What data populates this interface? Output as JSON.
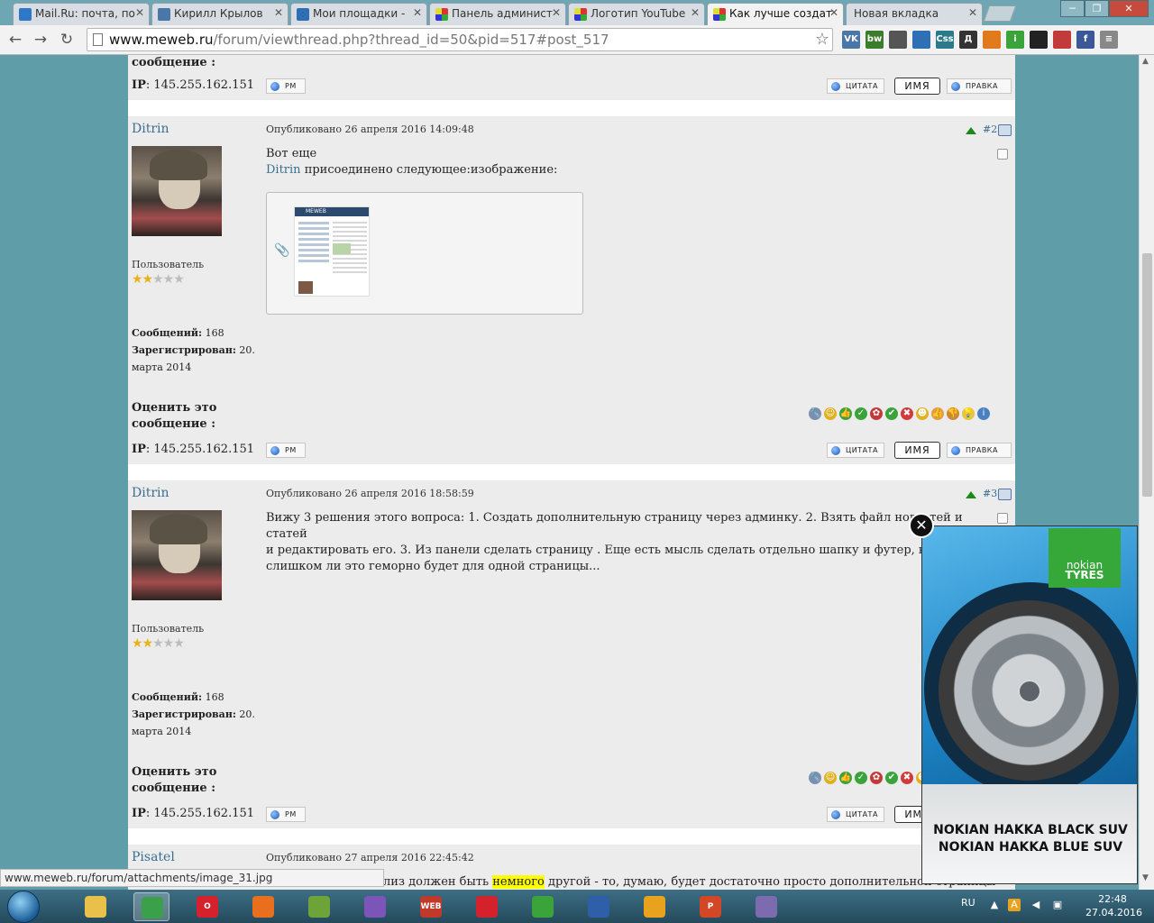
{
  "browser": {
    "tabs": [
      {
        "title": "Mail.Ru: почта, по",
        "color": "#2d79c7"
      },
      {
        "title": "Кирилл Крылов",
        "color": "#4a76a8"
      },
      {
        "title": "Мои площадки -",
        "color": "#2e6fb5"
      },
      {
        "title": "Панель админист",
        "color": "#c23b3b"
      },
      {
        "title": "Логотип YouTube",
        "color": "#c23b3b"
      },
      {
        "title": "Как лучше создат",
        "color": "#c23b3b"
      },
      {
        "title": "Новая вкладка",
        "color": ""
      }
    ],
    "url_host": "www.meweb.ru",
    "url_path": "/forum/viewthread.php?thread_id=50&pid=517#post_517",
    "extensions": [
      {
        "name": "vk-icon",
        "label": "VK",
        "color": "#4a76a8"
      },
      {
        "name": "bw-icon",
        "label": "bw",
        "color": "#3b7d2b"
      },
      {
        "name": "ruler-icon",
        "label": "",
        "color": "#555555"
      },
      {
        "name": "screen-icon",
        "label": "",
        "color": "#2f6fb3"
      },
      {
        "name": "css-icon",
        "label": "Css",
        "color": "#2b7a8c"
      },
      {
        "name": "dict-icon",
        "label": "Д",
        "color": "#333333"
      },
      {
        "name": "clock-icon",
        "label": "",
        "color": "#e07a1d"
      },
      {
        "name": "info-icon",
        "label": "i",
        "color": "#3aa33a"
      },
      {
        "name": "check-icon",
        "label": "",
        "color": "#222222"
      },
      {
        "name": "flag-icon",
        "label": "",
        "color": "#c23b3b"
      },
      {
        "name": "facebook-icon",
        "label": "f",
        "color": "#3b5998"
      },
      {
        "name": "menu-icon",
        "label": "≡",
        "color": "#888888"
      }
    ]
  },
  "forum": {
    "top_rate_tail": "сообщение :",
    "ip_label": "IP",
    "ip_value": ": 145.255.162.151",
    "btn_pm": "PM",
    "btn_quote": "ЦИТАТА",
    "btn_name": "ИМЯ",
    "btn_edit": "ПРАВКА",
    "rate_label_1": "Оценить это",
    "rate_label_2": "сообщение :",
    "posts": [
      {
        "author": "Ditrin",
        "posted": "Опубликовано 26 апреля 2016 14:09:48",
        "num": "#2",
        "body_line1": "Вот еще",
        "attach_user": "Ditrin",
        "attach_text": " присоединено следующее:изображение:",
        "role": "Пользователь",
        "stars_on": "★★",
        "stars_off": "★★★",
        "msgs_label": "Сообщений:",
        "msgs_value": " 168",
        "reg_label": "Зарегистрирован:",
        "reg_value": " 20.",
        "reg_value2": "марта 2014",
        "thumb_brand": "MEWEB"
      },
      {
        "author": "Ditrin",
        "posted": "Опубликовано 26 апреля 2016 18:58:59",
        "num": "#3",
        "body_l1": "Вижу 3 решения этого вопроса: 1. Создать дополнительную страницу через админку. 2. Взять файл новостей и статей",
        "body_l2": "и редактировать его. 3. Из панели сделать страницу . Еще есть мысль сделать отдельно шапку и футер, но вот",
        "body_l3": "слишком ли это геморно будет для одной страницы...",
        "role": "Пользователь",
        "stars_on": "★★",
        "stars_off": "★★★",
        "msgs_label": "Сообщений:",
        "msgs_value": " 168",
        "reg_label": "Зарегистрирован:",
        "reg_value": " 20.",
        "reg_value2": "марта 2014"
      },
      {
        "author": "Pisatel",
        "posted": "Опубликовано 27 апреля 2016 22:45:42",
        "body_pre": "лиз должен быть ",
        "body_hl": "немного",
        "body_post": " другой - то, думаю, будет достаточно просто дополнительной страницы"
      }
    ],
    "emoticons": [
      {
        "name": "wrench-icon",
        "glyph": "🔧",
        "color": "#7b8fb0"
      },
      {
        "name": "smile-icon",
        "glyph": "☺",
        "color": "#e0b020"
      },
      {
        "name": "thumbs-up-box-icon",
        "glyph": "👍",
        "color": "#3aa33a"
      },
      {
        "name": "ok-circle-icon",
        "glyph": "✓",
        "color": "#3aa33a"
      },
      {
        "name": "ribbon-icon",
        "glyph": "✿",
        "color": "#c23b3b"
      },
      {
        "name": "checkmark-icon",
        "glyph": "✔",
        "color": "#3aa33a"
      },
      {
        "name": "cross-icon",
        "glyph": "✖",
        "color": "#d13b3b"
      },
      {
        "name": "wink-icon",
        "glyph": "☻",
        "color": "#e0b020"
      },
      {
        "name": "thumbs-up-icon",
        "glyph": "👍",
        "color": "#e0a040"
      },
      {
        "name": "thumbs-down-icon",
        "glyph": "👎",
        "color": "#c98a3a"
      },
      {
        "name": "bulb-icon",
        "glyph": "💡",
        "color": "#e8c43a"
      },
      {
        "name": "info-circle-icon",
        "glyph": "i",
        "color": "#4a7fc0"
      }
    ]
  },
  "status_url": "www.meweb.ru/forum/attachments/image_31.jpg",
  "ad": {
    "brand_line1": "nokian",
    "brand_line2": "TYRES",
    "line1": "NOKIAN HAKKA BLACK SUV",
    "line2": "NOKIAN HAKKA BLUE SUV"
  },
  "taskbar": {
    "apps": [
      {
        "name": "explorer-icon",
        "label": "",
        "color": "#e8c04a"
      },
      {
        "name": "chrome-icon",
        "label": "",
        "color": "#3aa14a"
      },
      {
        "name": "opera-icon",
        "label": "O",
        "color": "#d4212b"
      },
      {
        "name": "firefox-icon",
        "label": "",
        "color": "#e76f1e"
      },
      {
        "name": "notepad-icon",
        "label": "",
        "color": "#6ea339"
      },
      {
        "name": "viber-icon",
        "label": "",
        "color": "#7b56b8"
      },
      {
        "name": "webcolor-icon",
        "label": "WEB",
        "color": "#c0392b"
      },
      {
        "name": "app-red-icon",
        "label": "",
        "color": "#d4212b"
      },
      {
        "name": "icq-icon",
        "label": "",
        "color": "#3aa33a"
      },
      {
        "name": "app-blue-icon",
        "label": "",
        "color": "#2f5fa8"
      },
      {
        "name": "aimp-icon",
        "label": "",
        "color": "#e8a21d"
      },
      {
        "name": "powerpoint-icon",
        "label": "P",
        "color": "#d24726"
      },
      {
        "name": "box-icon",
        "label": "",
        "color": "#7d6bb0"
      }
    ],
    "lang": "RU",
    "time": "22:48",
    "date": "27.04.2016"
  }
}
